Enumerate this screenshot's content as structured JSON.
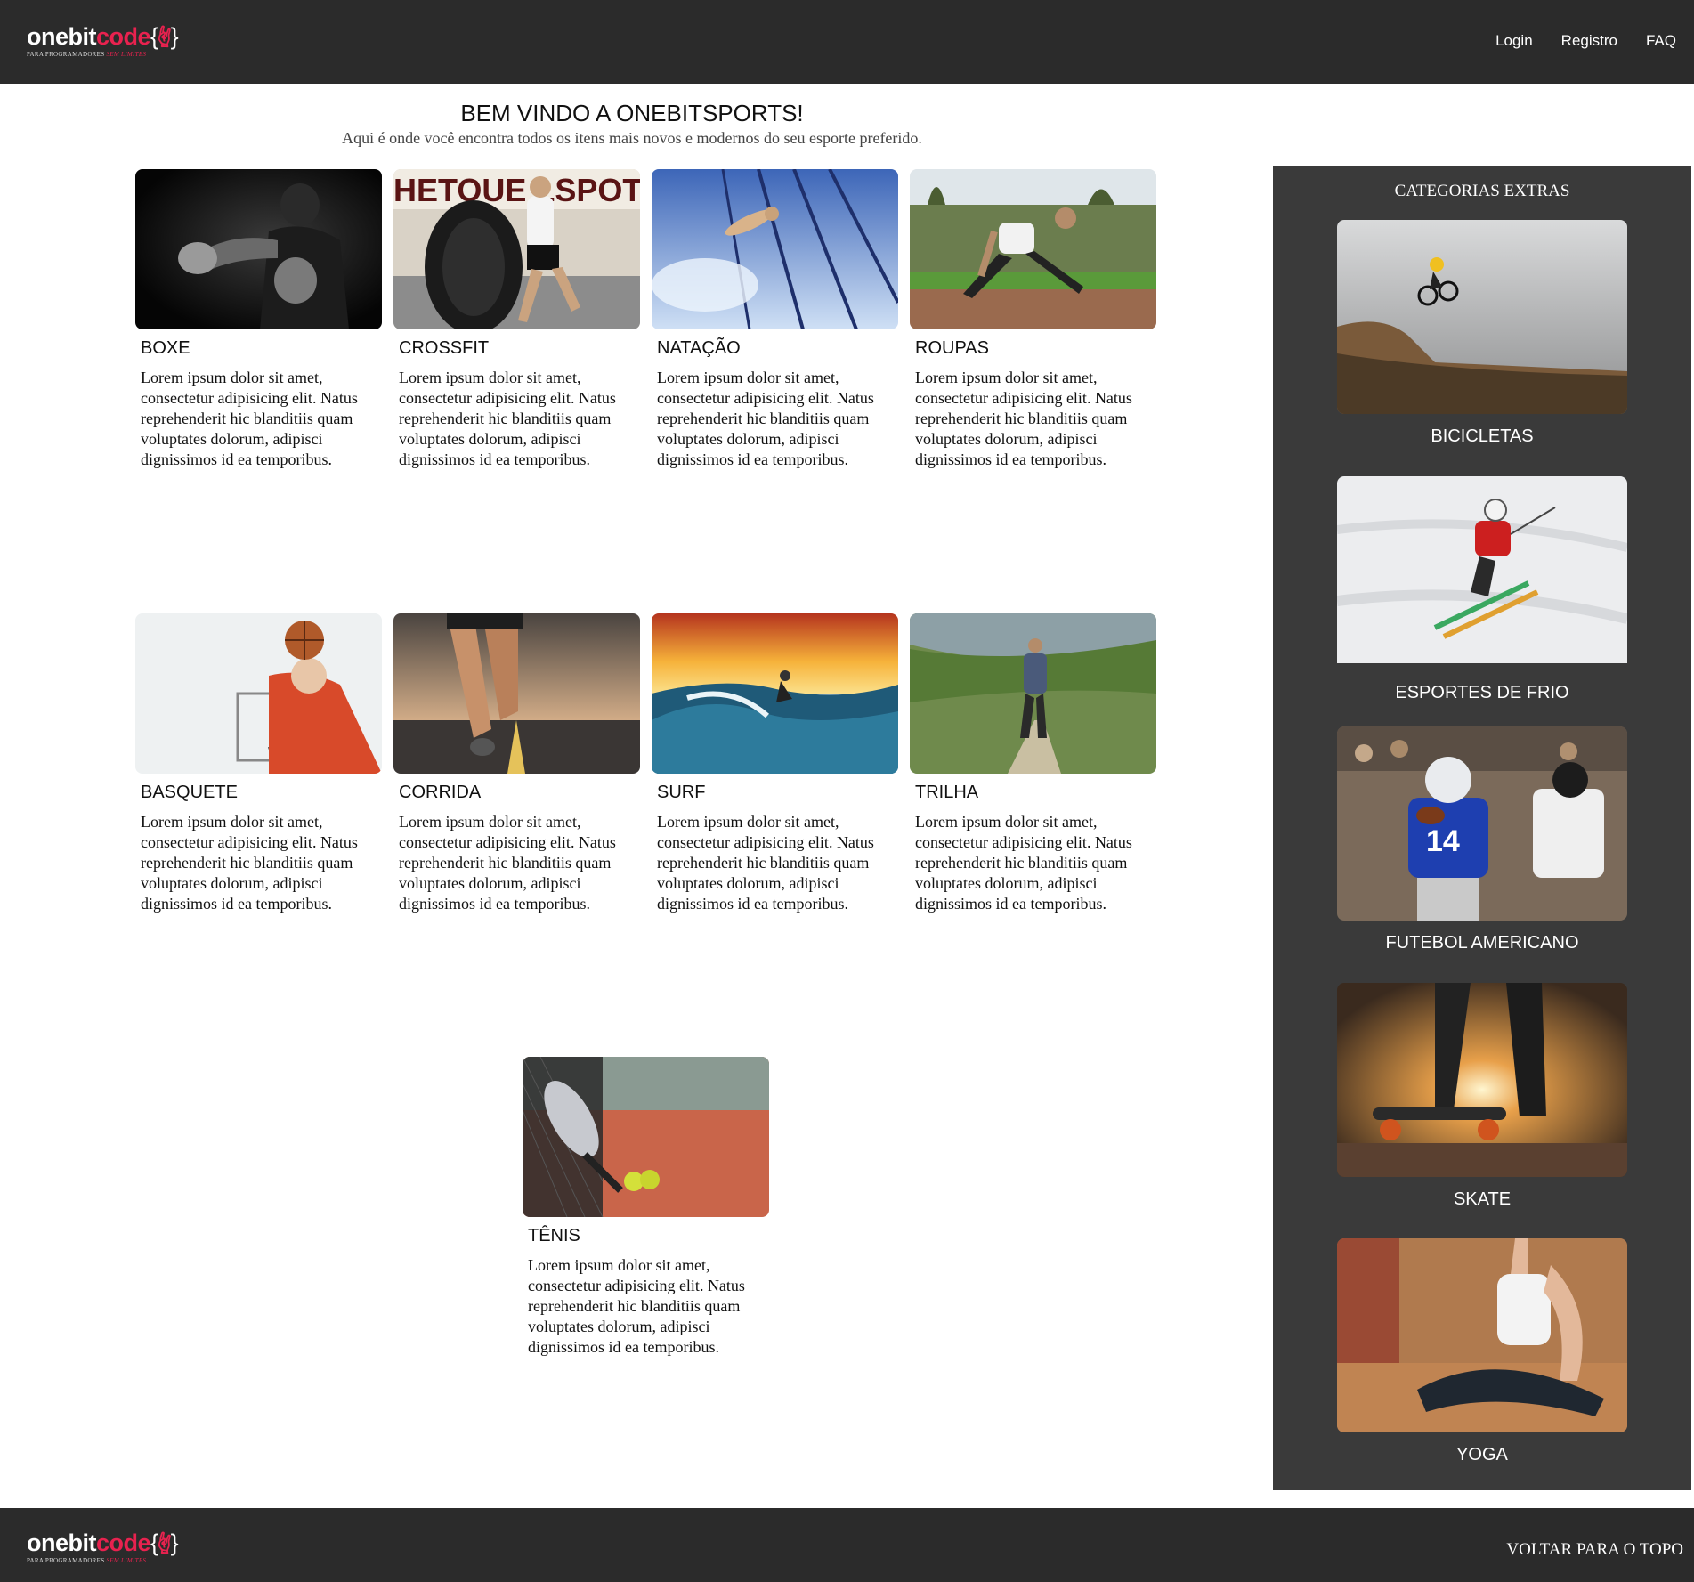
{
  "header": {
    "logo": {
      "name_white": "onebit",
      "name_red": "code",
      "brace_open": "{",
      "brace_close": "}",
      "tagline_white": "PARA PROGRAMADORES",
      "tagline_red": "SEM LIMITES"
    },
    "nav": [
      {
        "label": "Login"
      },
      {
        "label": "Registro"
      },
      {
        "label": "FAQ"
      }
    ]
  },
  "intro": {
    "title": "BEM VINDO A ONEBITSPORTS!",
    "subtitle": "Aqui é onde você encontra todos os itens mais novos e modernos do seu esporte preferido."
  },
  "cards": [
    {
      "title": "BOXE",
      "text": "Lorem ipsum dolor sit amet, consectetur adipisicing elit. Natus reprehenderit hic blanditiis quam voluptates dolorum, adipisci dignissimos id ea temporibus."
    },
    {
      "title": "CROSSFIT",
      "text": "Lorem ipsum dolor sit amet, consectetur adipisicing elit. Natus reprehenderit hic blanditiis quam voluptates dolorum, adipisci dignissimos id ea temporibus."
    },
    {
      "title": "NATAÇÃO",
      "text": "Lorem ipsum dolor sit amet, consectetur adipisicing elit. Natus reprehenderit hic blanditiis quam voluptates dolorum, adipisci dignissimos id ea temporibus."
    },
    {
      "title": "ROUPAS",
      "text": "Lorem ipsum dolor sit amet, consectetur adipisicing elit. Natus reprehenderit hic blanditiis quam voluptates dolorum, adipisci dignissimos id ea temporibus."
    },
    {
      "title": "BASQUETE",
      "text": "Lorem ipsum dolor sit amet, consectetur adipisicing elit. Natus reprehenderit hic blanditiis quam voluptates dolorum, adipisci dignissimos id ea temporibus."
    },
    {
      "title": "CORRIDA",
      "text": "Lorem ipsum dolor sit amet, consectetur adipisicing elit. Natus reprehenderit hic blanditiis quam voluptates dolorum, adipisci dignissimos id ea temporibus."
    },
    {
      "title": "SURF",
      "text": "Lorem ipsum dolor sit amet, consectetur adipisicing elit. Natus reprehenderit hic blanditiis quam voluptates dolorum, adipisci dignissimos id ea temporibus."
    },
    {
      "title": "TRILHA",
      "text": "Lorem ipsum dolor sit amet, consectetur adipisicing elit. Natus reprehenderit hic blanditiis quam voluptates dolorum, adipisci dignissimos id ea temporibus."
    },
    {
      "title": "TÊNIS",
      "text": "Lorem ipsum dolor sit amet, consectetur adipisicing elit. Natus reprehenderit hic blanditiis quam voluptates dolorum, adipisci dignissimos id ea temporibus."
    }
  ],
  "sidebar": {
    "title": "CATEGORIAS EXTRAS",
    "items": [
      {
        "label": "BICICLETAS"
      },
      {
        "label": "ESPORTES DE FRIO"
      },
      {
        "label": "FUTEBOL AMERICANO"
      },
      {
        "label": "SKATE"
      },
      {
        "label": "YOGA"
      }
    ]
  },
  "footer": {
    "back_to_top": "VOLTAR PARA O TOPO"
  },
  "colors": {
    "header_bg": "#2b2b2b",
    "sidebar_bg": "#3a3a3a",
    "brand_red": "#e8224f"
  }
}
